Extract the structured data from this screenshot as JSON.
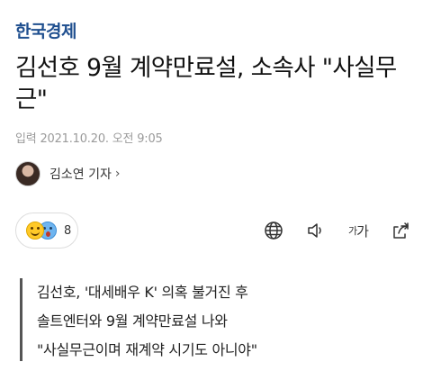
{
  "header": {
    "logo_text": "한국경제"
  },
  "article": {
    "title": "김선호 9월 계약만료설, 소속사 \"사실무근\"",
    "meta": "입력 2021.10.20. 오전 9:05",
    "author": {
      "name": "김소연 기자",
      "chevron": "›"
    },
    "reactions": {
      "icons": [
        "smile-emoji",
        "surprised-emoji"
      ],
      "count": "8"
    },
    "toolbar": {
      "icons": [
        "globe-icon",
        "speaker-icon",
        "font-size-icon",
        "share-icon"
      ],
      "font_size_small": "가",
      "font_size_large": "가"
    },
    "summary": [
      "김선호, '대세배우 K' 의혹 불거진 후",
      "솔트엔터와 9월 계약만료설 나와",
      "\"사실무근이며 재계약 시기도 아니야\""
    ]
  },
  "colors": {
    "logo": "#1f4f8f",
    "meta": "#9a9a9a",
    "summary_bar": "#555555"
  }
}
